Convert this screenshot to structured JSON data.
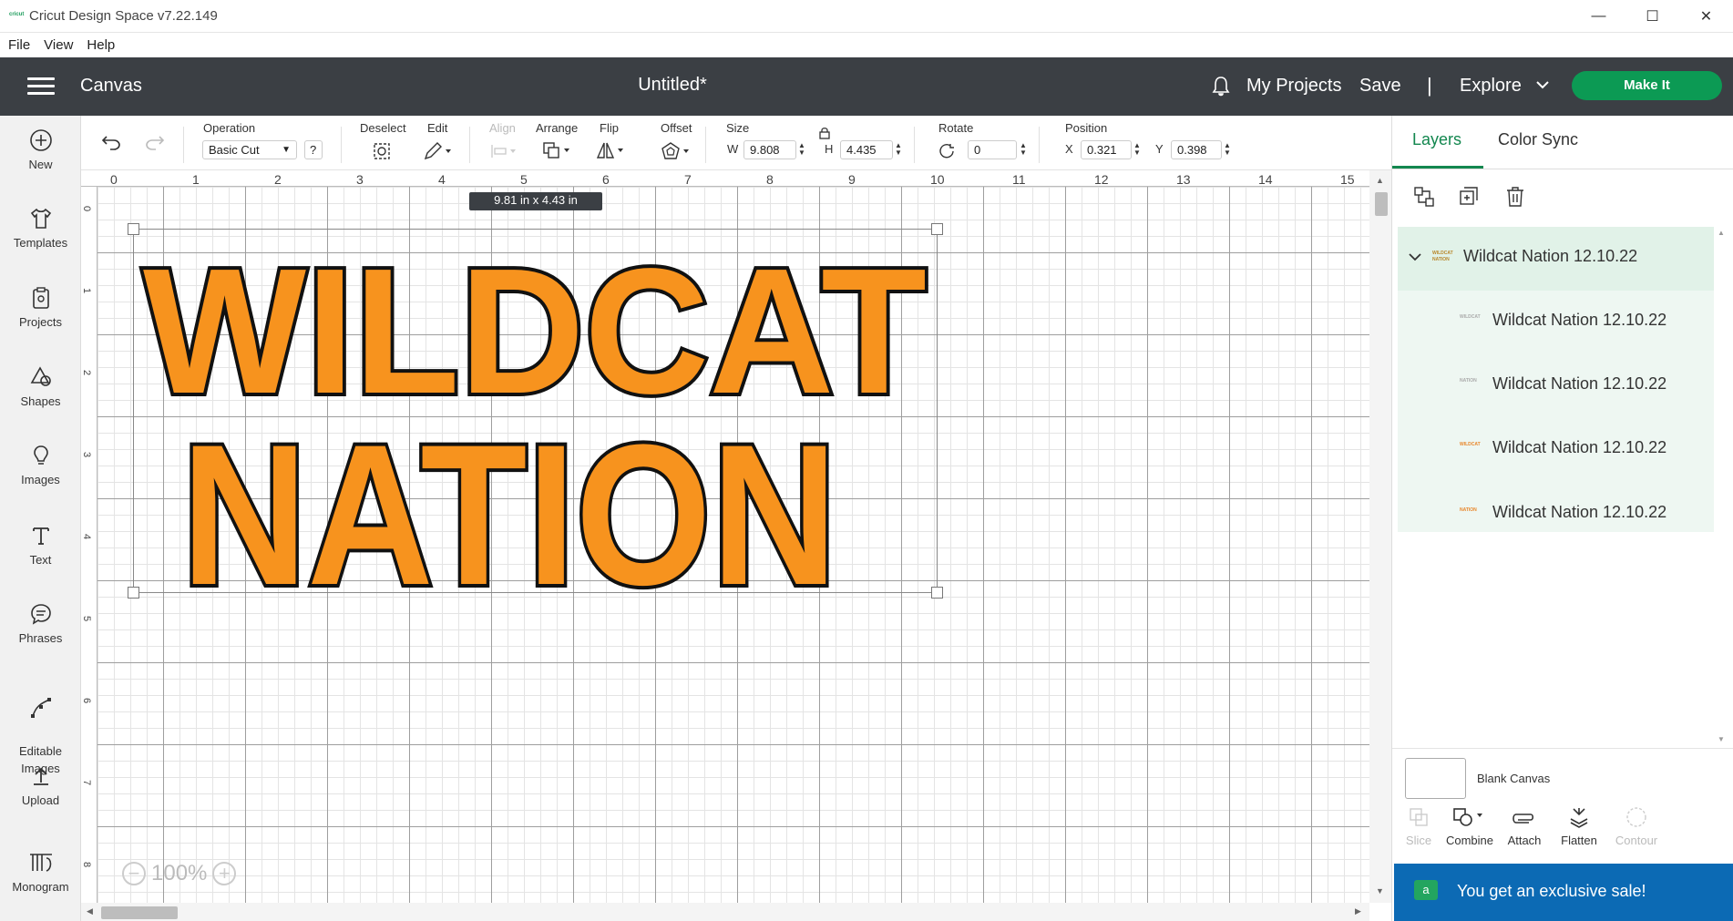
{
  "app": {
    "window_title": "Cricut Design Space  v7.22.149",
    "logo_text": "cricut",
    "menu": [
      "File",
      "View",
      "Help"
    ]
  },
  "header": {
    "section": "Canvas",
    "doc_title": "Untitled*",
    "my_projects": "My Projects",
    "save": "Save",
    "separator": "|",
    "explore": "Explore",
    "make_it": "Make It"
  },
  "sidebar": {
    "items": [
      {
        "label": "New",
        "icon": "plus-circle-icon"
      },
      {
        "label": "Templates",
        "icon": "shirt-icon"
      },
      {
        "label": "Projects",
        "icon": "clipboard-icon"
      },
      {
        "label": "Shapes",
        "icon": "shapes-icon"
      },
      {
        "label": "Images",
        "icon": "lightbulb-icon"
      },
      {
        "label": "Text",
        "icon": "text-t-icon"
      },
      {
        "label": "Phrases",
        "icon": "speech-bubble-icon"
      },
      {
        "label": "Editable\nImages",
        "icon": "node-edit-icon"
      },
      {
        "label": "Upload",
        "icon": "upload-icon"
      },
      {
        "label": "Monogram",
        "icon": "monogram-icon"
      }
    ]
  },
  "toolbar": {
    "operation_label": "Operation",
    "operation_value": "Basic Cut",
    "help": "?",
    "deselect": "Deselect",
    "edit": "Edit",
    "align": "Align",
    "arrange": "Arrange",
    "flip": "Flip",
    "offset": "Offset",
    "size": "Size",
    "w_label": "W",
    "w_value": "9.808",
    "h_label": "H",
    "h_value": "4.435",
    "rotate": "Rotate",
    "rotate_value": "0",
    "position": "Position",
    "x_label": "X",
    "x_value": "0.321",
    "y_label": "Y",
    "y_value": "0.398"
  },
  "canvas": {
    "ruler_top": [
      "0",
      "1",
      "2",
      "3",
      "4",
      "5",
      "6",
      "7",
      "8",
      "9",
      "10",
      "11",
      "12",
      "13",
      "14",
      "15"
    ],
    "ruler_left": [
      "0",
      "1",
      "2",
      "3",
      "4",
      "5",
      "6",
      "7",
      "8"
    ],
    "size_tip": "9.81  in x 4.43  in",
    "design_line1": "WILDCAT",
    "design_line2": "NATION",
    "zoom": "100%",
    "fill_color": "#f7931e",
    "outline_color": "#111111"
  },
  "layers_panel": {
    "tabs": [
      "Layers",
      "Color Sync"
    ],
    "group_name": "Wildcat Nation 12.10.22",
    "children": [
      {
        "name": "Wildcat Nation 12.10.22",
        "thumb": "WILDCAT"
      },
      {
        "name": "Wildcat Nation 12.10.22",
        "thumb": "NATION"
      },
      {
        "name": "Wildcat Nation 12.10.22",
        "thumb": "WILDCAT"
      },
      {
        "name": "Wildcat Nation 12.10.22",
        "thumb": "NATION"
      }
    ],
    "blank_canvas": "Blank Canvas",
    "bottom_tools": [
      "Slice",
      "Combine",
      "Attach",
      "Flatten",
      "Contour"
    ]
  },
  "promo": {
    "icon_text": "a",
    "text": "You get an exclusive sale!"
  },
  "colors": {
    "accent_green": "#0c9a54",
    "header_bg": "#3b3f44",
    "promo_blue": "#0c6ab4"
  }
}
